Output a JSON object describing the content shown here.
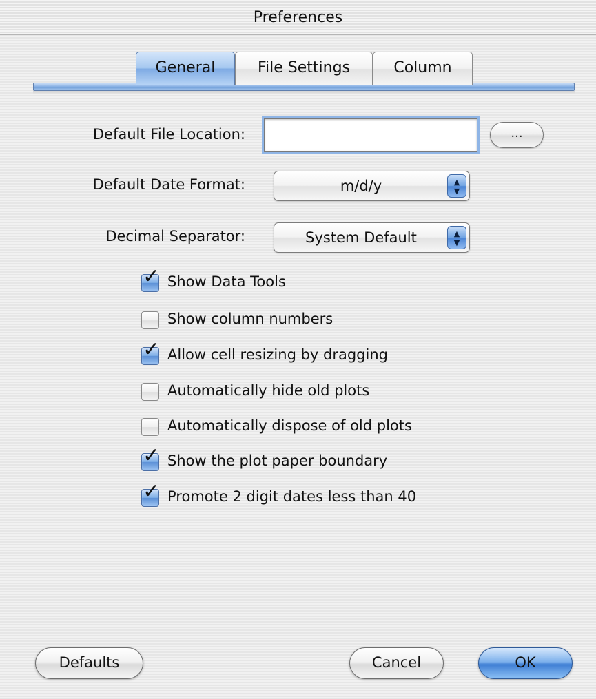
{
  "window": {
    "title": "Preferences"
  },
  "tabs": [
    {
      "label": "General",
      "selected": true
    },
    {
      "label": "File Settings",
      "selected": false
    },
    {
      "label": "Column",
      "selected": false
    }
  ],
  "form": {
    "file_location": {
      "label": "Default File Location:",
      "value": "",
      "browse_label": "..."
    },
    "date_format": {
      "label": "Default Date Format:",
      "selected": "m/d/y"
    },
    "decimal_separator": {
      "label": "Decimal Separator:",
      "selected": "System Default"
    }
  },
  "checkboxes": [
    {
      "label": "Show Data Tools",
      "checked": true
    },
    {
      "label": "Show column numbers",
      "checked": false
    },
    {
      "label": "Allow cell resizing by dragging",
      "checked": true
    },
    {
      "label": "Automatically hide old plots",
      "checked": false
    },
    {
      "label": "Automatically dispose of old plots",
      "checked": false
    },
    {
      "label": "Show the plot paper boundary",
      "checked": true
    },
    {
      "label": "Promote 2 digit dates less than 40",
      "checked": true
    }
  ],
  "buttons": {
    "defaults": "Defaults",
    "cancel": "Cancel",
    "ok": "OK"
  },
  "colors": {
    "accent": "#6d9cd8",
    "window_background": "#ececec"
  },
  "icons": {
    "popup_arrows": "up-down-arrows-icon",
    "checkmark": "checkmark-icon"
  }
}
